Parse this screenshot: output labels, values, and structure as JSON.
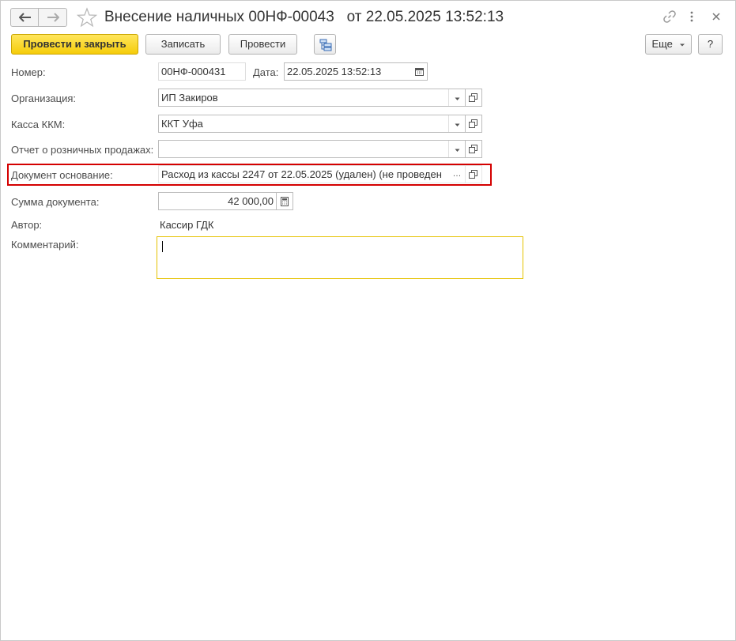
{
  "window": {
    "title": "Внесение наличных 00НФ-00043   от 22.05.2025 13:52:13"
  },
  "icons": {
    "back": "arrow-left-icon",
    "forward": "arrow-right-icon",
    "favorite": "star-icon",
    "link": "link-icon",
    "more": "vertical-dots-icon",
    "close": "close-icon"
  },
  "toolbar": {
    "post_and_close": "Провести и закрыть",
    "save": "Записать",
    "post": "Провести",
    "more": "Еще",
    "help": "?"
  },
  "form": {
    "number": {
      "label": "Номер:",
      "value": "00НФ-000431"
    },
    "date": {
      "label": "Дата:",
      "value": "22.05.2025 13:52:13"
    },
    "organization": {
      "label": "Организация:",
      "value": "ИП Закиров"
    },
    "cash_register": {
      "label": "Касса ККМ:",
      "value": "ККТ Уфа"
    },
    "retail_report": {
      "label": "Отчет о розничных продажах:",
      "value": ""
    },
    "base_document": {
      "label": "Документ основание:",
      "value": "Расход из кассы 2247 от 22.05.2025 (удален) (не проведен"
    },
    "amount": {
      "label": "Сумма документа:",
      "value": "42 000,00"
    },
    "author": {
      "label": "Автор:",
      "value": "Кассир ГДК"
    },
    "comment": {
      "label": "Комментарий:",
      "value": ""
    }
  },
  "colors": {
    "primary_button": "#f5cc0a",
    "highlight_border": "#d40000",
    "focused_field_border": "#e6c200"
  }
}
